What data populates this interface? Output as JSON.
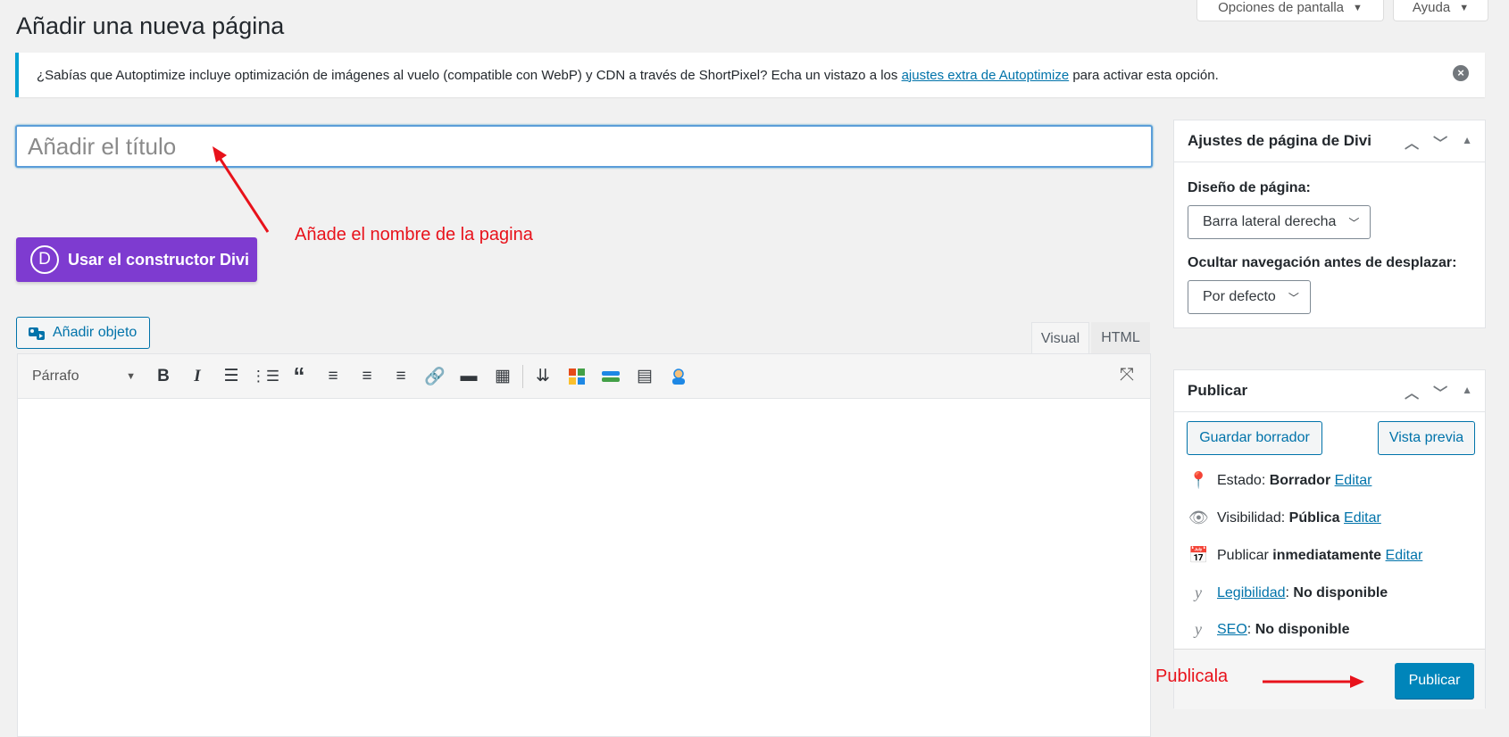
{
  "screen_options": {
    "options_label": "Opciones de pantalla",
    "help_label": "Ayuda"
  },
  "page_title": "Añadir una nueva página",
  "notice": {
    "text_before": "¿Sabías que Autoptimize incluye optimización de imágenes al vuelo (compatible con WebP) y CDN a través de ShortPixel? Echa un vistazo a los ",
    "link": "ajustes extra de Autoptimize",
    "text_after": " para activar esta opción."
  },
  "title_field": {
    "placeholder": "Añadir el título",
    "value": ""
  },
  "annotations": {
    "title_hint": "Añade el nombre de la pagina",
    "publish_hint": "Publicala"
  },
  "divi_button": {
    "label": "Usar el constructor Divi",
    "letter": "D"
  },
  "media_button": {
    "label": "Añadir objeto"
  },
  "editor_tabs": {
    "visual": "Visual",
    "html": "HTML"
  },
  "toolbar": {
    "format_select": "Párrafo"
  },
  "divi_settings": {
    "title": "Ajustes de página de Divi",
    "layout_label": "Diseño de página:",
    "layout_value": "Barra lateral derecha",
    "hide_nav_label": "Ocultar navegación antes de desplazar:",
    "hide_nav_value": "Por defecto"
  },
  "publish": {
    "title": "Publicar",
    "save_draft": "Guardar borrador",
    "preview": "Vista previa",
    "status_label": "Estado:",
    "status_value": "Borrador",
    "visibility_label": "Visibilidad:",
    "visibility_value": "Pública",
    "schedule_label": "Publicar",
    "schedule_value": "inmediatamente",
    "edit": "Editar",
    "readability_link": "Legibilidad",
    "readability_value": "No disponible",
    "seo_link": "SEO",
    "seo_value": "No disponible",
    "publish_button": "Publicar"
  },
  "colors": {
    "divi_purple": "#7e3bd0",
    "wp_blue": "#0085ba",
    "annotation_red": "#e8121b",
    "notice_border": "#00a0d2"
  }
}
